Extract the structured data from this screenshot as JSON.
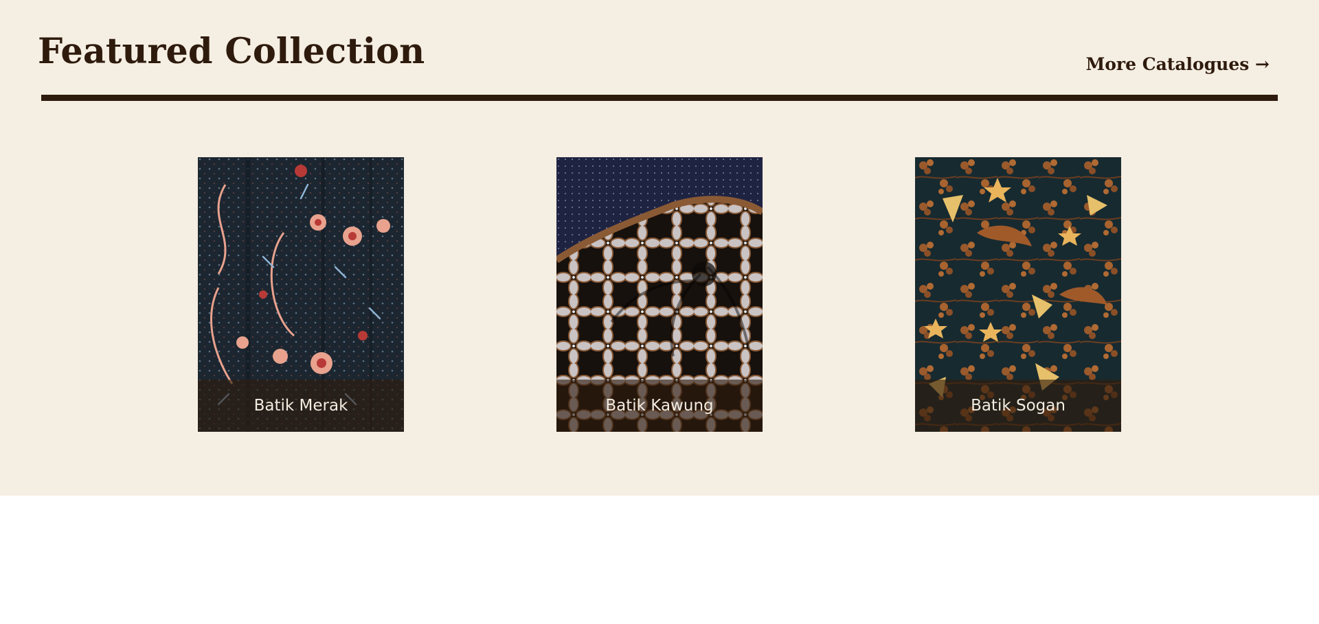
{
  "header": {
    "title": "Featured Collection",
    "more_link": "More Catalogues →"
  },
  "colors": {
    "section_background": "#f5eee2",
    "accent_dark_brown": "#2e1b0d",
    "label_text": "#f3ece0"
  },
  "collection": {
    "items": [
      {
        "label": "Batik Merak",
        "pattern": "dark blue-black batik with peacock motifs in salmon, red and light blue"
      },
      {
        "label": "Batik Kawung",
        "pattern": "draped black batik with brown and white kawung oval motifs and navy dotted border"
      },
      {
        "label": "Batik Sogan",
        "pattern": "dark teal batik with brown floral clusters and golden leaf motifs"
      }
    ]
  }
}
